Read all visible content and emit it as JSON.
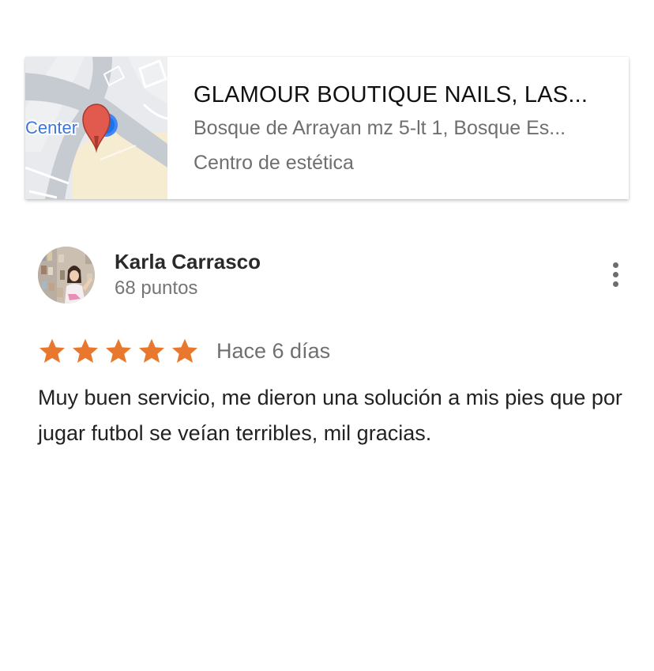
{
  "place": {
    "name": "GLAMOUR BOUTIQUE NAILS, LAS...",
    "address": "Bosque de Arrayan mz 5-lt 1, Bosque Es...",
    "category": "Centro de estética",
    "map_label": "Center",
    "pin_color": "#e15a4d"
  },
  "review": {
    "author": "Karla Carrasco",
    "points": "68 puntos",
    "rating": 5,
    "rating_max": 5,
    "star_color": "#e8782e",
    "time": "Hace 6 días",
    "text": "Muy buen servicio, me dieron una solución a mis pies que por jugar futbol se veían terribles, mil gracias."
  },
  "icons": {
    "menu": "more-vert-icon",
    "star": "star-icon",
    "pin": "map-pin-icon"
  }
}
